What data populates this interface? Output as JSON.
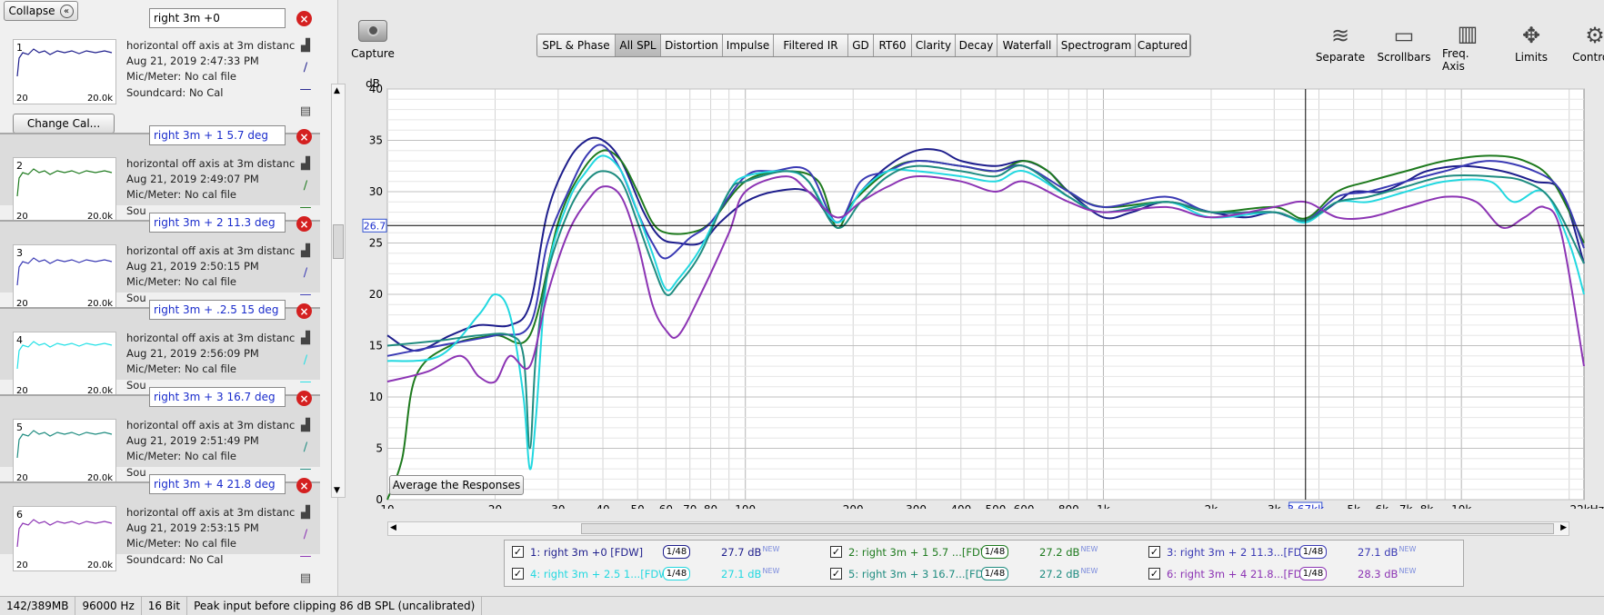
{
  "collapse_label": "Collapse",
  "change_cal_label": "Change Cal...",
  "thumb_range": {
    "lo": "20",
    "hi": "20.0k"
  },
  "measurements": [
    {
      "num": "1",
      "name": "right 3m +0",
      "desc": "horizontal off axis at 3m distanc",
      "date": "Aug 21, 2019 2:47:33 PM",
      "mic": "Mic/Meter: No cal file",
      "sound": "Soundcard: No Cal",
      "color": "#1e1e8c"
    },
    {
      "num": "2",
      "name": "right 3m + 1  5.7 deg",
      "desc": "horizontal off axis at 3m distanc",
      "date": "Aug 21, 2019 2:49:07 PM",
      "mic": "Mic/Meter: No cal file",
      "sound": "Sou",
      "color": "#1e7a1e"
    },
    {
      "num": "3",
      "name": "right 3m + 2 11.3 deg",
      "desc": "horizontal off axis at 3m distanc",
      "date": "Aug 21, 2019 2:50:15 PM",
      "mic": "Mic/Meter: No cal file",
      "sound": "Sou",
      "color": "#3a3ab4"
    },
    {
      "num": "4",
      "name": "right 3m + .2.5  15 deg",
      "desc": "horizontal off axis at 3m distanc",
      "date": "Aug 21, 2019 2:56:09 PM",
      "mic": "Mic/Meter: No cal file",
      "sound": "Sou",
      "color": "#22e0e6"
    },
    {
      "num": "5",
      "name": "right 3m + 3 16.7 deg",
      "desc": "horizontal off axis at 3m distanc",
      "date": "Aug 21, 2019 2:51:49 PM",
      "mic": "Mic/Meter: No cal file",
      "sound": "Sou",
      "color": "#1f8c80"
    },
    {
      "num": "6",
      "name": "right 3m + 4 21.8 deg",
      "desc": "horizontal off axis at 3m distanc",
      "date": "Aug 21, 2019 2:53:15 PM",
      "mic": "Mic/Meter: No cal file",
      "sound": "Soundcard: No Cal",
      "color": "#8c34b4"
    }
  ],
  "capture_label": "Capture",
  "tabs": [
    "SPL & Phase",
    "All SPL",
    "Distortion",
    "Impulse",
    "Filtered IR",
    "GD",
    "RT60",
    "Clarity",
    "Decay",
    "Waterfall",
    "Spectrogram",
    "Captured"
  ],
  "active_tab": "All SPL",
  "right_tools": [
    {
      "label": "Separate",
      "icon": "separate-icon"
    },
    {
      "label": "Scrollbars",
      "icon": "scrollbars-icon"
    },
    {
      "label": "Freq. Axis",
      "icon": "freq-axis-icon"
    },
    {
      "label": "Limits",
      "icon": "limits-icon"
    },
    {
      "label": "Controls",
      "icon": "gear-icon"
    }
  ],
  "chart_data": {
    "type": "line",
    "ylabel": "dB",
    "ylim": [
      0,
      40
    ],
    "xlim": [
      10,
      22000
    ],
    "xscale": "log",
    "yticks": [
      "0",
      "5",
      "10",
      "15",
      "20",
      "25",
      "30",
      "35",
      "40"
    ],
    "xticks": [
      "10",
      "20",
      "30",
      "40",
      "50",
      "60",
      "70",
      "80",
      "100",
      "200",
      "300",
      "400",
      "500",
      "600",
      "800",
      "1k",
      "2k",
      "3k",
      "3.67kk",
      "5k",
      "6k",
      "7k",
      "8k",
      "10k",
      "22kHz"
    ],
    "cursor": {
      "x_label": "3.67kk",
      "y_label": "26.7",
      "x": 3670,
      "y": 26.7
    },
    "average_button": "Average the Responses",
    "grid": true,
    "series": [
      {
        "name": "1: right 3m +0 [FDW]",
        "points": [
          [
            10,
            16
          ],
          [
            12,
            14.5
          ],
          [
            15,
            16
          ],
          [
            18,
            17
          ],
          [
            22,
            17
          ],
          [
            25,
            19
          ],
          [
            28,
            28
          ],
          [
            32,
            33
          ],
          [
            36,
            35
          ],
          [
            40,
            35
          ],
          [
            45,
            33
          ],
          [
            52,
            28
          ],
          [
            58,
            25.5
          ],
          [
            65,
            25
          ],
          [
            75,
            25
          ],
          [
            85,
            27
          ],
          [
            100,
            29
          ],
          [
            120,
            30
          ],
          [
            150,
            30
          ],
          [
            180,
            27
          ],
          [
            210,
            30
          ],
          [
            250,
            32.5
          ],
          [
            300,
            34
          ],
          [
            350,
            34
          ],
          [
            400,
            33
          ],
          [
            500,
            32.5
          ],
          [
            600,
            33
          ],
          [
            700,
            32
          ],
          [
            800,
            30
          ],
          [
            1000,
            27.5
          ],
          [
            1200,
            28
          ],
          [
            1500,
            29
          ],
          [
            2000,
            28
          ],
          [
            2500,
            27.5
          ],
          [
            3000,
            28
          ],
          [
            3670,
            27.2
          ],
          [
            4500,
            29
          ],
          [
            5000,
            30
          ],
          [
            6000,
            30
          ],
          [
            7000,
            31
          ],
          [
            8000,
            32
          ],
          [
            10000,
            32.5
          ],
          [
            13000,
            32
          ],
          [
            16000,
            31
          ],
          [
            19000,
            30
          ],
          [
            22000,
            23
          ]
        ]
      },
      {
        "name": "2: right 3m + 1  5.7 ...[FDW]",
        "points": [
          [
            10,
            0
          ],
          [
            11,
            4
          ],
          [
            12,
            12
          ],
          [
            15,
            15
          ],
          [
            20,
            16
          ],
          [
            25,
            16
          ],
          [
            30,
            27
          ],
          [
            35,
            32
          ],
          [
            40,
            34
          ],
          [
            45,
            33
          ],
          [
            50,
            30
          ],
          [
            55,
            27
          ],
          [
            60,
            26
          ],
          [
            70,
            26
          ],
          [
            80,
            27
          ],
          [
            100,
            31
          ],
          [
            130,
            32
          ],
          [
            160,
            31
          ],
          [
            180,
            26.5
          ],
          [
            200,
            29
          ],
          [
            250,
            32
          ],
          [
            300,
            33
          ],
          [
            400,
            32.5
          ],
          [
            500,
            32
          ],
          [
            600,
            33
          ],
          [
            700,
            32
          ],
          [
            800,
            30
          ],
          [
            1000,
            28.5
          ],
          [
            1500,
            29
          ],
          [
            2000,
            28
          ],
          [
            3000,
            28.5
          ],
          [
            3670,
            27.4
          ],
          [
            4500,
            30
          ],
          [
            5500,
            31
          ],
          [
            7000,
            32
          ],
          [
            9000,
            33
          ],
          [
            12000,
            33.5
          ],
          [
            15000,
            33
          ],
          [
            18000,
            31
          ],
          [
            22000,
            25
          ]
        ]
      },
      {
        "name": "3: right 3m + 2 11.3...[FDW]",
        "points": [
          [
            10,
            14
          ],
          [
            14,
            15
          ],
          [
            20,
            16
          ],
          [
            25,
            17
          ],
          [
            28,
            25
          ],
          [
            32,
            30
          ],
          [
            36,
            33.5
          ],
          [
            40,
            34.5
          ],
          [
            45,
            32
          ],
          [
            50,
            28
          ],
          [
            55,
            25
          ],
          [
            60,
            23.5
          ],
          [
            70,
            25.5
          ],
          [
            80,
            27
          ],
          [
            100,
            31.5
          ],
          [
            120,
            32
          ],
          [
            150,
            32
          ],
          [
            180,
            27
          ],
          [
            210,
            31
          ],
          [
            250,
            32
          ],
          [
            300,
            33
          ],
          [
            400,
            32.5
          ],
          [
            500,
            32
          ],
          [
            600,
            32.5
          ],
          [
            800,
            30
          ],
          [
            1000,
            28.5
          ],
          [
            1500,
            29.5
          ],
          [
            2000,
            28
          ],
          [
            3000,
            28
          ],
          [
            3670,
            27.2
          ],
          [
            4500,
            29.5
          ],
          [
            5500,
            30
          ],
          [
            7000,
            31
          ],
          [
            9000,
            32
          ],
          [
            12000,
            33
          ],
          [
            16000,
            32
          ],
          [
            19000,
            30
          ],
          [
            22000,
            24.5
          ]
        ]
      },
      {
        "name": "4: right 3m +  2.5  1...[FDW]",
        "points": [
          [
            10,
            13.5
          ],
          [
            14,
            14
          ],
          [
            18,
            18
          ],
          [
            20,
            20
          ],
          [
            22,
            18
          ],
          [
            24,
            10
          ],
          [
            25,
            3
          ],
          [
            26,
            8
          ],
          [
            28,
            22
          ],
          [
            32,
            29
          ],
          [
            36,
            32
          ],
          [
            40,
            33.5
          ],
          [
            45,
            32
          ],
          [
            50,
            28
          ],
          [
            55,
            24
          ],
          [
            60,
            20.5
          ],
          [
            65,
            21.5
          ],
          [
            75,
            24.5
          ],
          [
            90,
            30
          ],
          [
            100,
            31.5
          ],
          [
            130,
            32
          ],
          [
            150,
            31
          ],
          [
            180,
            27
          ],
          [
            210,
            30
          ],
          [
            250,
            32
          ],
          [
            300,
            32
          ],
          [
            400,
            31.5
          ],
          [
            500,
            31
          ],
          [
            600,
            32
          ],
          [
            800,
            29.5
          ],
          [
            1000,
            28
          ],
          [
            1500,
            29
          ],
          [
            2000,
            27.5
          ],
          [
            3000,
            28
          ],
          [
            3670,
            27
          ],
          [
            4500,
            29
          ],
          [
            5500,
            29
          ],
          [
            7000,
            30
          ],
          [
            9000,
            31
          ],
          [
            12000,
            31
          ],
          [
            14000,
            29
          ],
          [
            17000,
            30
          ],
          [
            20000,
            25
          ],
          [
            22000,
            20
          ]
        ]
      },
      {
        "name": "5: right 3m + 3 16.7...[FDW]",
        "points": [
          [
            10,
            15
          ],
          [
            14,
            15.5
          ],
          [
            18,
            16
          ],
          [
            22,
            16
          ],
          [
            24,
            14
          ],
          [
            25,
            5
          ],
          [
            26,
            14
          ],
          [
            28,
            22
          ],
          [
            32,
            28
          ],
          [
            36,
            31
          ],
          [
            40,
            32
          ],
          [
            45,
            31
          ],
          [
            50,
            27
          ],
          [
            55,
            23
          ],
          [
            60,
            20
          ],
          [
            65,
            21
          ],
          [
            75,
            24
          ],
          [
            90,
            30
          ],
          [
            100,
            31
          ],
          [
            130,
            32
          ],
          [
            150,
            31
          ],
          [
            180,
            26.5
          ],
          [
            210,
            29
          ],
          [
            250,
            31.5
          ],
          [
            300,
            32.5
          ],
          [
            400,
            32
          ],
          [
            500,
            31.5
          ],
          [
            600,
            32.5
          ],
          [
            800,
            29.5
          ],
          [
            1000,
            28
          ],
          [
            1500,
            29
          ],
          [
            2000,
            28
          ],
          [
            3000,
            28
          ],
          [
            3670,
            27.2
          ],
          [
            4500,
            29
          ],
          [
            5500,
            29.5
          ],
          [
            7000,
            30.5
          ],
          [
            9000,
            31.5
          ],
          [
            12000,
            31.5
          ],
          [
            15000,
            31
          ],
          [
            18000,
            29
          ],
          [
            22000,
            23
          ]
        ]
      },
      {
        "name": "6: right 3m + 4 21.8...[FDW]",
        "points": [
          [
            10,
            11.5
          ],
          [
            13,
            12.5
          ],
          [
            16,
            14
          ],
          [
            18,
            12
          ],
          [
            20,
            11.5
          ],
          [
            22,
            14
          ],
          [
            25,
            13
          ],
          [
            28,
            20
          ],
          [
            32,
            26
          ],
          [
            36,
            29
          ],
          [
            40,
            30.5
          ],
          [
            45,
            29.5
          ],
          [
            50,
            25
          ],
          [
            55,
            19
          ],
          [
            60,
            16.5
          ],
          [
            65,
            16
          ],
          [
            75,
            20
          ],
          [
            90,
            26
          ],
          [
            100,
            30
          ],
          [
            130,
            31.5
          ],
          [
            150,
            30
          ],
          [
            180,
            27.5
          ],
          [
            210,
            29
          ],
          [
            250,
            30.5
          ],
          [
            300,
            31.5
          ],
          [
            400,
            31
          ],
          [
            500,
            30
          ],
          [
            600,
            31
          ],
          [
            800,
            29
          ],
          [
            1000,
            28
          ],
          [
            1500,
            28.5
          ],
          [
            2000,
            27.5
          ],
          [
            3000,
            28.5
          ],
          [
            3670,
            29
          ],
          [
            4500,
            27.5
          ],
          [
            5500,
            27.5
          ],
          [
            7000,
            28.5
          ],
          [
            9000,
            29.5
          ],
          [
            11000,
            29
          ],
          [
            13000,
            26.5
          ],
          [
            15000,
            27.5
          ],
          [
            17000,
            28.5
          ],
          [
            19000,
            26
          ],
          [
            22000,
            13
          ]
        ]
      }
    ]
  },
  "legend": [
    {
      "label": "1: right 3m +0 [FDW]",
      "oct": "1/48",
      "value": "27.7 dB",
      "new": "NEW",
      "color": "#1e1e8c"
    },
    {
      "label": "2: right 3m + 1  5.7 ...[FDW]",
      "oct": "1/48",
      "value": "27.2 dB",
      "new": "NEW",
      "color": "#1e7a1e"
    },
    {
      "label": "3: right 3m + 2 11.3...[FDW]",
      "oct": "1/48",
      "value": "27.1 dB",
      "new": "NEW",
      "color": "#3a3ab4"
    },
    {
      "label": "4: right 3m +  2.5  1...[FDW]",
      "oct": "1/48",
      "value": "27.1 dB",
      "new": "NEW",
      "color": "#22d8e0"
    },
    {
      "label": "5: right 3m + 3 16.7...[FDW]",
      "oct": "1/48",
      "value": "27.2 dB",
      "new": "NEW",
      "color": "#1f8c80"
    },
    {
      "label": "6: right 3m + 4 21.8...[FDW]",
      "oct": "1/48",
      "value": "28.3 dB",
      "new": "NEW",
      "color": "#8c34b4"
    }
  ],
  "status": {
    "memory": "142/389MB",
    "rate": "96000 Hz",
    "bits": "16 Bit",
    "peak": "Peak input before clipping 86 dB SPL (uncalibrated)"
  }
}
